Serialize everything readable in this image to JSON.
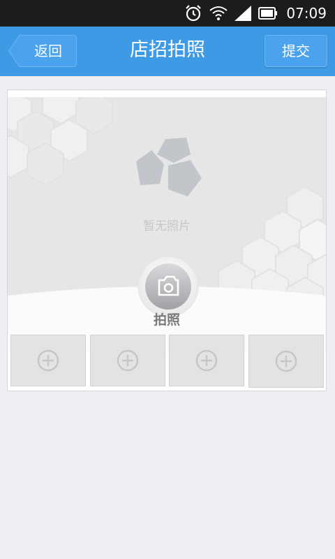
{
  "status_bar": {
    "time": "07:09",
    "icons": [
      "alarm-icon",
      "wifi-icon",
      "signal-icon",
      "battery-icon"
    ]
  },
  "header": {
    "back_label": "返回",
    "title": "店招拍照",
    "submit_label": "提交"
  },
  "photo": {
    "empty_text": "暂无照片",
    "take_photo_label": "拍照"
  },
  "thumbnails": [
    {
      "icon": "add-icon"
    },
    {
      "icon": "add-icon"
    },
    {
      "icon": "add-icon"
    },
    {
      "icon": "add-icon"
    }
  ],
  "colors": {
    "header": "#3f9ae5",
    "status_bar": "#1c1c1c",
    "background": "#efeff3"
  }
}
